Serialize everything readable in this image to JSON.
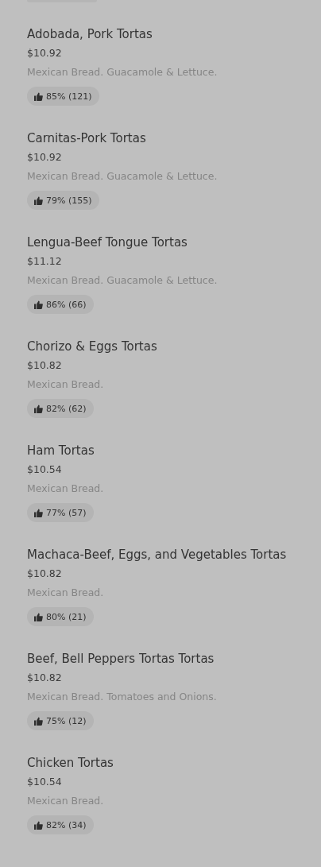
{
  "items": [
    {
      "name": "Adobada, Pork Tortas",
      "price": "$10.92",
      "description": "Mexican Bread. Guacamole & Lettuce.",
      "rating": "85% (121)"
    },
    {
      "name": "Carnitas-Pork Tortas",
      "price": "$10.92",
      "description": "Mexican Bread. Guacamole & Lettuce.",
      "rating": "79% (155)"
    },
    {
      "name": "Lengua-Beef Tongue Tortas",
      "price": "$11.12",
      "description": "Mexican Bread. Guacamole & Lettuce.",
      "rating": "86% (66)"
    },
    {
      "name": "Chorizo & Eggs Tortas",
      "price": "$10.82",
      "description": "Mexican Bread.",
      "rating": "82% (62)"
    },
    {
      "name": "Ham Tortas",
      "price": "$10.54",
      "description": "Mexican Bread.",
      "rating": "77% (57)"
    },
    {
      "name": "Machaca-Beef, Eggs, and Vegetables Tortas",
      "price": "$10.82",
      "description": "Mexican Bread.",
      "rating": "80% (21)"
    },
    {
      "name": "Beef, Bell Peppers Tortas Tortas",
      "price": "$10.82",
      "description": "Mexican Bread. Tomatoes and Onions.",
      "rating": "75% (12)"
    },
    {
      "name": "Chicken Tortas",
      "price": "$10.54",
      "description": "Mexican Bread.",
      "rating": "82% (34)"
    }
  ]
}
